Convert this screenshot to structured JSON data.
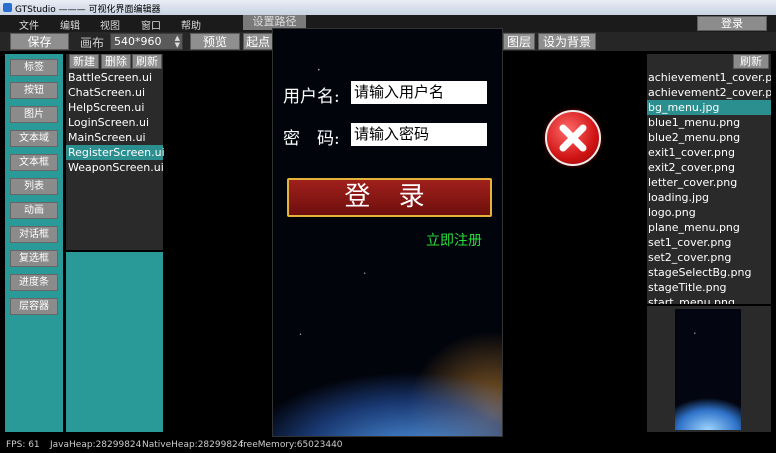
{
  "window": {
    "title": "GTStudio ——— 可视化界面编辑器"
  },
  "menu": {
    "items": [
      "文件",
      "编辑",
      "视图",
      "窗口",
      "帮助"
    ],
    "settings_tab": "设置路径",
    "login": "登录"
  },
  "toolbar": {
    "save": "保存",
    "canvas_label": "画布",
    "canvas_size": "540*960",
    "preview": "预览",
    "start_point": "起点",
    "layer": "图层",
    "set_background": "设为背景"
  },
  "widgets": [
    "标签",
    "按钮",
    "图片",
    "文本域",
    "文本框",
    "列表",
    "动画",
    "对话框",
    "复选框",
    "进度条",
    "层容器"
  ],
  "file_panel": {
    "new": "新建",
    "delete": "删除",
    "refresh": "刷新",
    "files": [
      "BattleScreen.ui",
      "ChatScreen.ui",
      "HelpScreen.ui",
      "LoginScreen.ui",
      "MainScreen.ui",
      "RegisterScreen.ui",
      "WeaponScreen.ui"
    ],
    "selected_index": 5
  },
  "canvas": {
    "username_label": "用户名:",
    "username_placeholder": "请输入用户名",
    "password_label": "密　码:",
    "password_placeholder": "请输入密码",
    "login_button": "登 录",
    "register_link": "立即注册"
  },
  "resources": {
    "refresh": "刷新",
    "items": [
      "achievement1_cover.png",
      "achievement2_cover.png",
      "bg_menu.jpg",
      "blue1_menu.png",
      "blue2_menu.png",
      "exit1_cover.png",
      "exit2_cover.png",
      "letter_cover.png",
      "loading.jpg",
      "logo.png",
      "plane_menu.png",
      "set1_cover.png",
      "set2_cover.png",
      "stageSelectBg.png",
      "stageTitle.png",
      "start_menu.png"
    ],
    "selected_index": 2
  },
  "status": {
    "fps": "FPS: 61",
    "java_heap": "JavaHeap:28299824",
    "native_heap": "NativeHeap:28299824",
    "free_memory": "freeMemory:65023440"
  },
  "colors": {
    "teal": "#2a9a99",
    "selected": "#2a8f8e",
    "register_green": "#2cdd3d",
    "login_red": "#8c1512"
  },
  "icons": {
    "close": "close-icon",
    "app": "app-icon"
  }
}
